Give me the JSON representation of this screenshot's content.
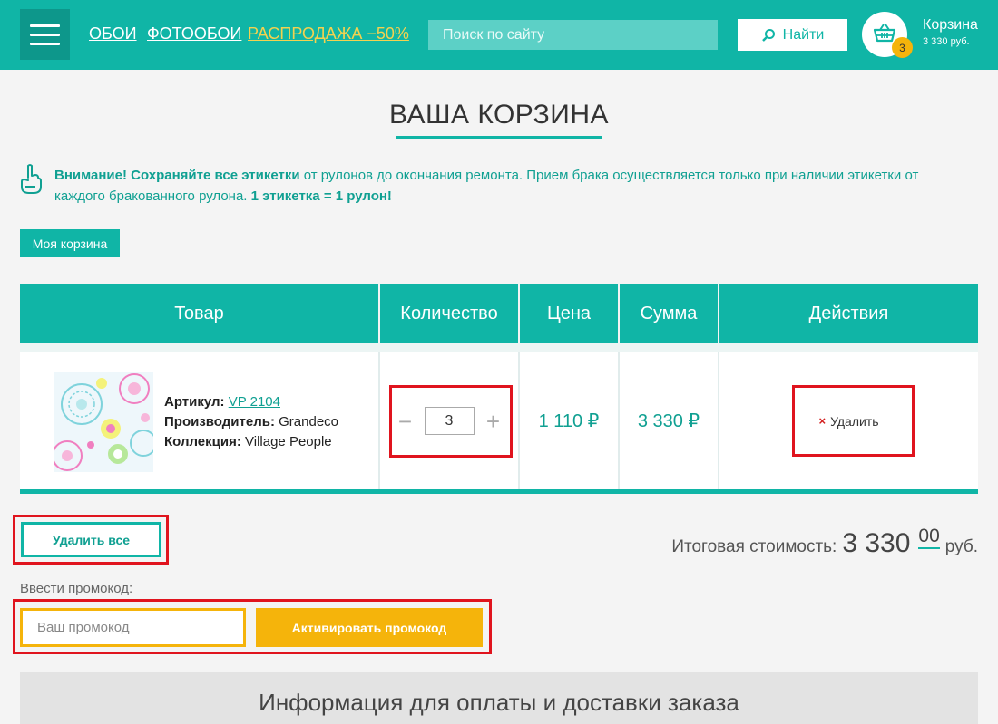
{
  "header": {
    "nav": [
      "ОБОИ",
      "ФОТООБОИ",
      "РАСПРОДАЖА −50%"
    ],
    "search_placeholder": "Поиск по сайту",
    "search_button": "Найти",
    "cart": {
      "label": "Корзина",
      "sum": "3 330 руб.",
      "count": "3"
    },
    "colors": {
      "brand": "#10b5a6",
      "sale": "#f3d24f",
      "badge": "#f5b40b"
    }
  },
  "page": {
    "title": "ВАША КОРЗИНА",
    "notice": {
      "bold1": "Внимание! Сохраняйте все этикетки",
      "text1": " от рулонов до окончания ремонта. Прием брака осуществляется только при наличии этикетки от каждого бракованного рулона. ",
      "bold2": "1 этикетка = 1 рулон!"
    },
    "tab": "Моя корзина"
  },
  "table": {
    "headers": [
      "Товар",
      "Количество",
      "Цена",
      "Сумма",
      "Действия"
    ],
    "rows": [
      {
        "article_label": "Артикул:",
        "article": "VP 2104",
        "maker_label": "Производитель:",
        "maker": "Grandeco",
        "collection_label": "Коллекция:",
        "collection": "Village People",
        "qty": "3",
        "qty_minus": "−",
        "qty_plus": "+",
        "price": "1 110 ₽",
        "sum": "3 330 ₽",
        "delete": "Удалить",
        "delete_icon": "×"
      }
    ]
  },
  "footer": {
    "delete_all": "Удалить все",
    "total_label": "Итоговая стоимость:",
    "total_main": "3 330",
    "total_kop": "00",
    "total_cur": "руб.",
    "promo_label": "Ввести промокод:",
    "promo_placeholder": "Ваш промокод",
    "promo_button": "Активировать промокод",
    "info_title": "Информация для оплаты и доставки заказа"
  }
}
